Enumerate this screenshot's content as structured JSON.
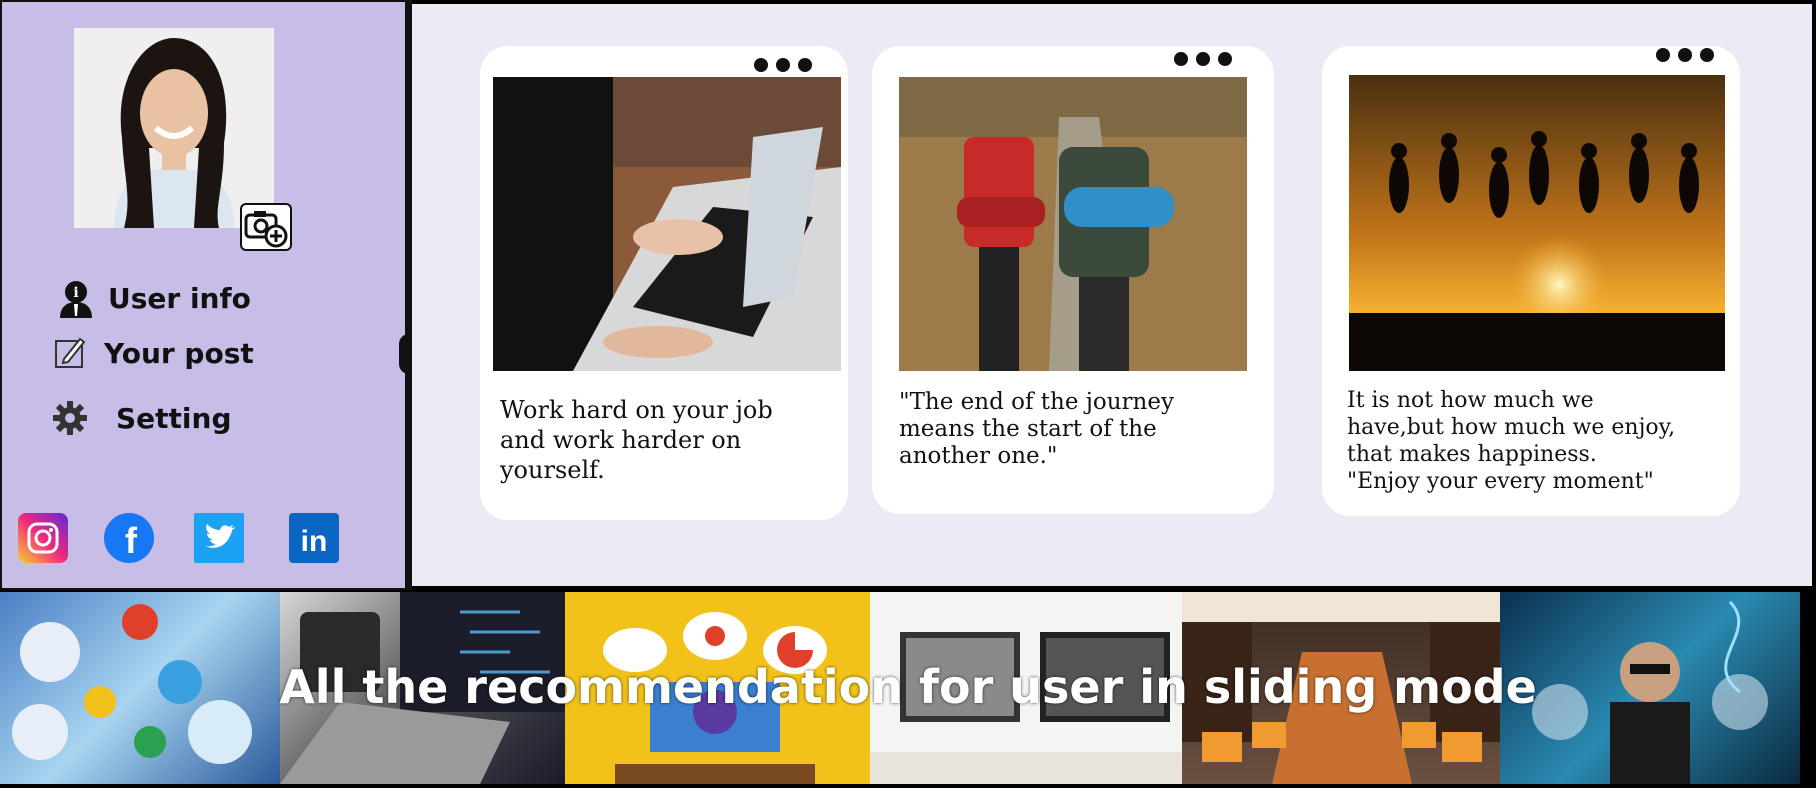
{
  "sidebar": {
    "avatar_alt": "user avatar",
    "menu": [
      {
        "label": "User info",
        "icon": "user-info-icon"
      },
      {
        "label": "Your post",
        "icon": "edit-post-icon"
      },
      {
        "label": "Setting",
        "icon": "gear-icon"
      }
    ],
    "social": [
      "instagram-icon",
      "facebook-icon",
      "twitter-icon",
      "linkedin-icon"
    ]
  },
  "cards": [
    {
      "quote": "Work hard on your job\nand work harder on\nyourself."
    },
    {
      "quote": "\"The end of the journey\nmeans the start of the\nanother one.\""
    },
    {
      "quote": "It is not how much we\nhave,but how much we enjoy,\nthat makes happiness.\n \"Enjoy your every moment\""
    }
  ],
  "recommendation": {
    "caption": "All the recommendation for user in sliding mode"
  },
  "colors": {
    "sidebar_bg": "#c7bde6",
    "main_bg": "#ebebf6",
    "facebook": "#1877f2",
    "twitter": "#1da1f2",
    "linkedin": "#0a66c2"
  }
}
